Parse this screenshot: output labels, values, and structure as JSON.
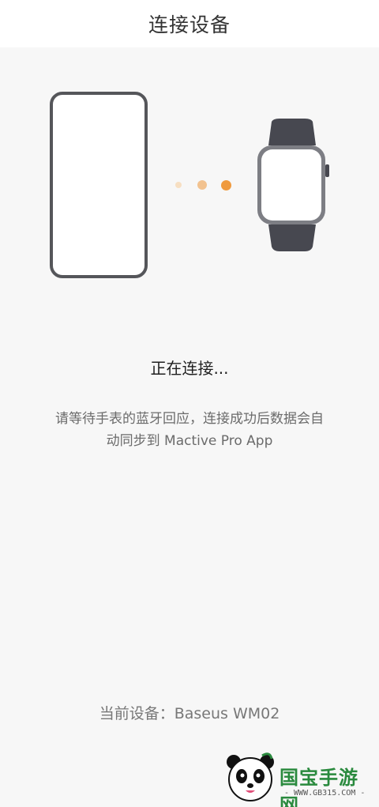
{
  "header": {
    "title": "连接设备"
  },
  "illustration": {
    "phone_icon": "phone-icon",
    "watch_icon": "smartwatch-icon",
    "dot_colors": [
      "#f7dfc2",
      "#f2c28f",
      "#ef9a3e"
    ]
  },
  "status": {
    "text": "正在连接..."
  },
  "description": {
    "line1": "请等待手表的蓝牙回应，连接成功后数据会自",
    "line2": "动同步到 Mactive Pro App"
  },
  "device": {
    "label": "当前设备：",
    "value": "Baseus WM02"
  },
  "watermark": {
    "brand": "国宝手游网",
    "url": "- WWW.GB315.COM -"
  },
  "colors": {
    "accent": "#ef9a3e",
    "device_frame": "#55565a",
    "watch_band": "#474850"
  }
}
